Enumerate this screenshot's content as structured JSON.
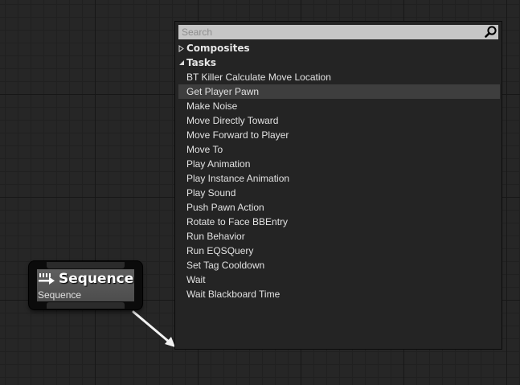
{
  "node": {
    "icon": "sequence-icon",
    "title": "Sequence",
    "subtitle": "Sequence"
  },
  "menu": {
    "search_placeholder": "Search",
    "search_value": "",
    "categories": [
      {
        "label": "Composites",
        "expanded": false
      },
      {
        "label": "Tasks",
        "expanded": true
      }
    ],
    "tasks": [
      "BT Killer Calculate Move Location",
      "Get Player Pawn",
      "Make Noise",
      "Move Directly Toward",
      "Move Forward to Player",
      "Move To",
      "Play Animation",
      "Play Instance Animation",
      "Play Sound",
      "Push Pawn Action",
      "Rotate to Face BBEntry",
      "Run Behavior",
      "Run EQSQuery",
      "Set Tag Cooldown",
      "Wait",
      "Wait Blackboard Time"
    ],
    "selected_task": "Get Player Pawn"
  },
  "colors": {
    "background": "#262626",
    "menu_background": "#242424",
    "selected_row": "#3e3e3e",
    "node_body": "#575757"
  }
}
